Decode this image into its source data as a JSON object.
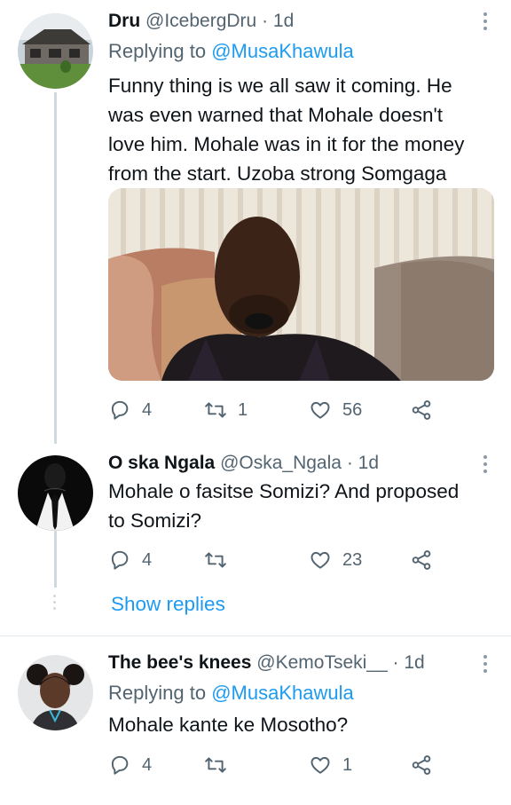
{
  "tweets": [
    {
      "name": "Dru",
      "handle": "@IcebergDru",
      "time": "· 1d",
      "replying_prefix": "Replying to ",
      "replying_to": "@MusaKhawula",
      "text": "Funny thing is we all saw it coming. He was even warned that Mohale doesn't love him. Mohale was in it for the money from the start. Uzoba strong Somgaga",
      "replies": "4",
      "retweets": "1",
      "likes": "56"
    },
    {
      "name": "O ska Ngala",
      "handle": "@Oska_Ngala",
      "time": "· 1d",
      "text": "Mohale o fasitse Somizi? And proposed to Somizi?",
      "replies": "4",
      "retweets": "",
      "likes": "23"
    },
    {
      "name": "The bee's knees",
      "handle": "@KemoTseki__",
      "time": "· 1d",
      "replying_prefix": "Replying to ",
      "replying_to": "@MusaKhawula",
      "text": "Mohale kante ke Mosotho?",
      "replies": "4",
      "retweets": "",
      "likes": "1"
    }
  ],
  "show_replies_label": "Show replies",
  "colors": {
    "accent": "#1d9bf0",
    "muted": "#536471",
    "line": "#cfd9de"
  },
  "icons": [
    "reply-icon",
    "retweet-icon",
    "like-icon",
    "share-icon",
    "more-icon"
  ]
}
